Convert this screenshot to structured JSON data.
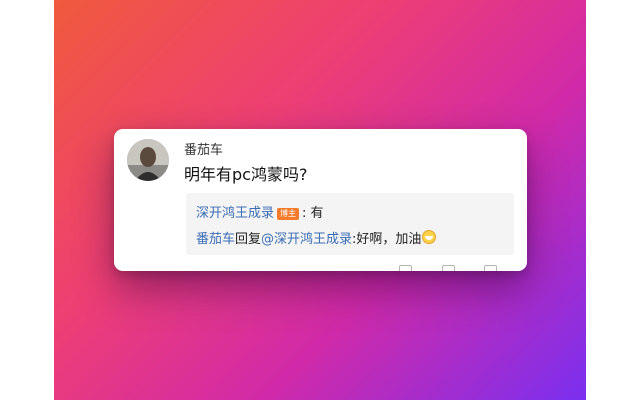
{
  "comment": {
    "username": "番茄车",
    "text": "明年有pc鸿蒙吗?"
  },
  "replies": [
    {
      "author": "深开鸿王成录",
      "badge": "博主",
      "separator": ": ",
      "text": "有"
    },
    {
      "author": "番茄车",
      "connector": "回复",
      "mention": "@深开鸿王成录",
      "text": ":好啊，加油",
      "emoji": "grin-emoji-icon"
    }
  ],
  "colors": {
    "link": "#3a6db5",
    "badge": "#f47b2b",
    "gradient": [
      "#f05a3c",
      "#ee3f73",
      "#d12aa8",
      "#7a2ff0"
    ]
  }
}
